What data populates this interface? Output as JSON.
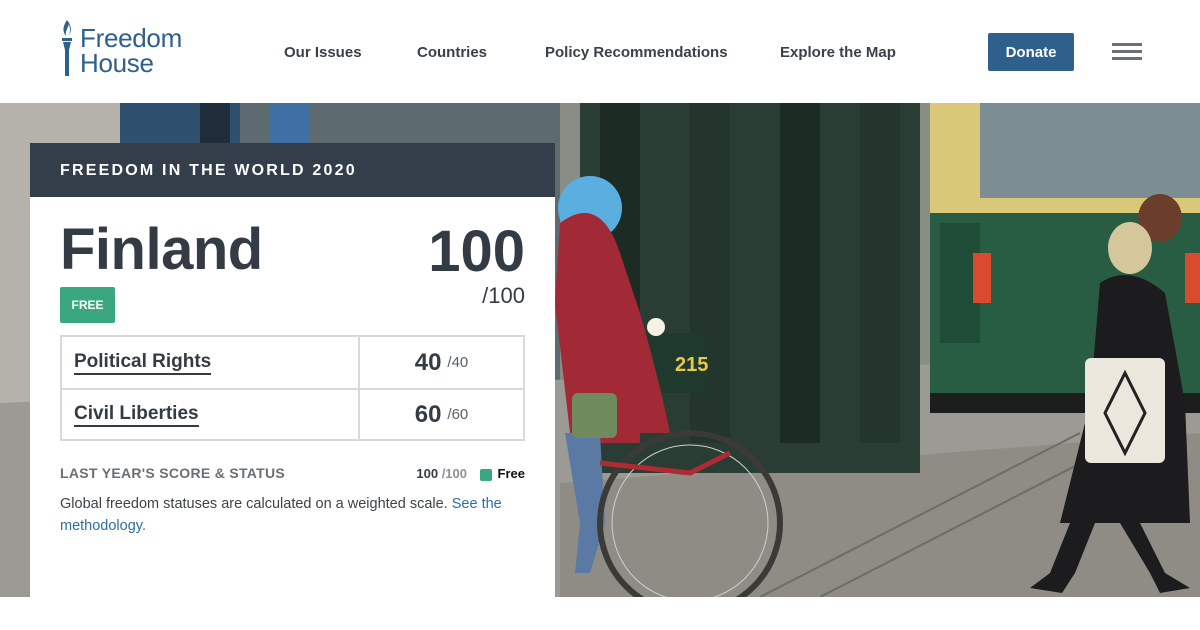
{
  "brand": {
    "line1": "Freedom",
    "line2": "House",
    "color": "#2f5f8c"
  },
  "nav": {
    "items": [
      "Our Issues",
      "Countries",
      "Policy Recommendations",
      "Explore the Map"
    ],
    "donate_label": "Donate"
  },
  "card": {
    "header": "FREEDOM IN THE WORLD 2020",
    "country": "Finland",
    "status_badge": "FREE",
    "total_score": "100",
    "total_max": "/100",
    "scores": [
      {
        "label": "Political Rights",
        "value": "40",
        "max": "/40"
      },
      {
        "label": "Civil Liberties",
        "value": "60",
        "max": "/60"
      }
    ],
    "last_year": {
      "label": "LAST YEAR'S SCORE & STATUS",
      "score": "100",
      "max": "/100",
      "status": "Free"
    },
    "note": "Global freedom statuses are calculated on a weighted scale.",
    "note_link": "See the methodology."
  },
  "colors": {
    "free": "#3aa77e",
    "header_bg": "#333e4a",
    "accent": "#2f5f8c"
  },
  "hero": {
    "tram_number": "215"
  }
}
